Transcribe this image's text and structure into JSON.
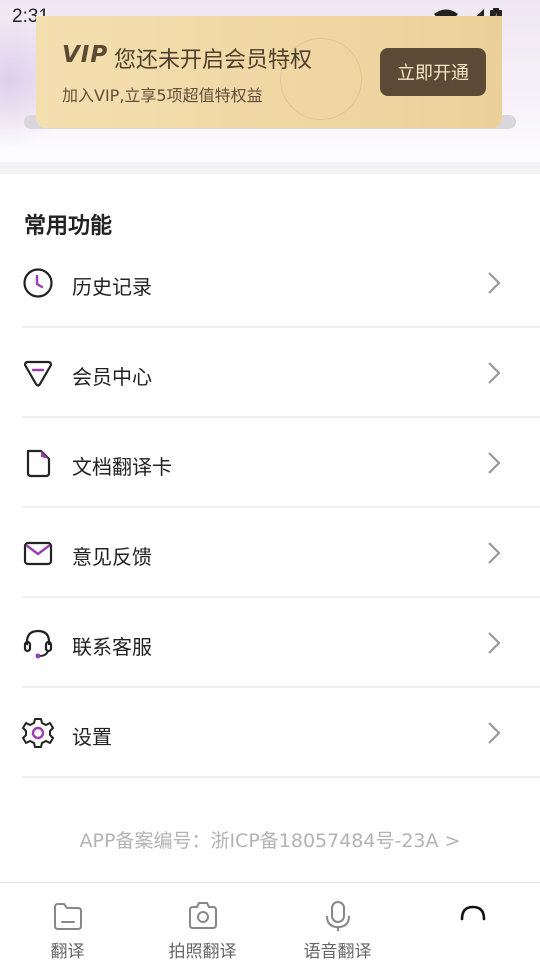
{
  "status_bar": {
    "time": "2:31"
  },
  "vip": {
    "logo": "VIP",
    "title": "您还未开启会员特权",
    "subtitle": "加入VIP,立享5项超值特权益",
    "button_label": "立即开通"
  },
  "section": {
    "title": "常用功能"
  },
  "menu": [
    {
      "label": "历史记录",
      "icon": "clock-icon"
    },
    {
      "label": "会员中心",
      "icon": "diamond-icon"
    },
    {
      "label": "文档翻译卡",
      "icon": "document-icon"
    },
    {
      "label": "意见反馈",
      "icon": "mail-icon"
    },
    {
      "label": "联系客服",
      "icon": "headset-icon"
    },
    {
      "label": "设置",
      "icon": "gear-icon"
    }
  ],
  "footer": {
    "icp": "APP备案编号：浙ICP备18057484号-23A >"
  },
  "bottom_nav": [
    {
      "label": "翻译",
      "icon": "folder-icon"
    },
    {
      "label": "拍照翻译",
      "icon": "camera-icon"
    },
    {
      "label": "语音翻译",
      "icon": "microphone-icon"
    },
    {
      "label": "",
      "icon": "loading-icon"
    }
  ],
  "colors": {
    "accent": "#9b3fb0",
    "vip_bg": "#f0d7a4",
    "vip_button": "#5b4a35"
  }
}
